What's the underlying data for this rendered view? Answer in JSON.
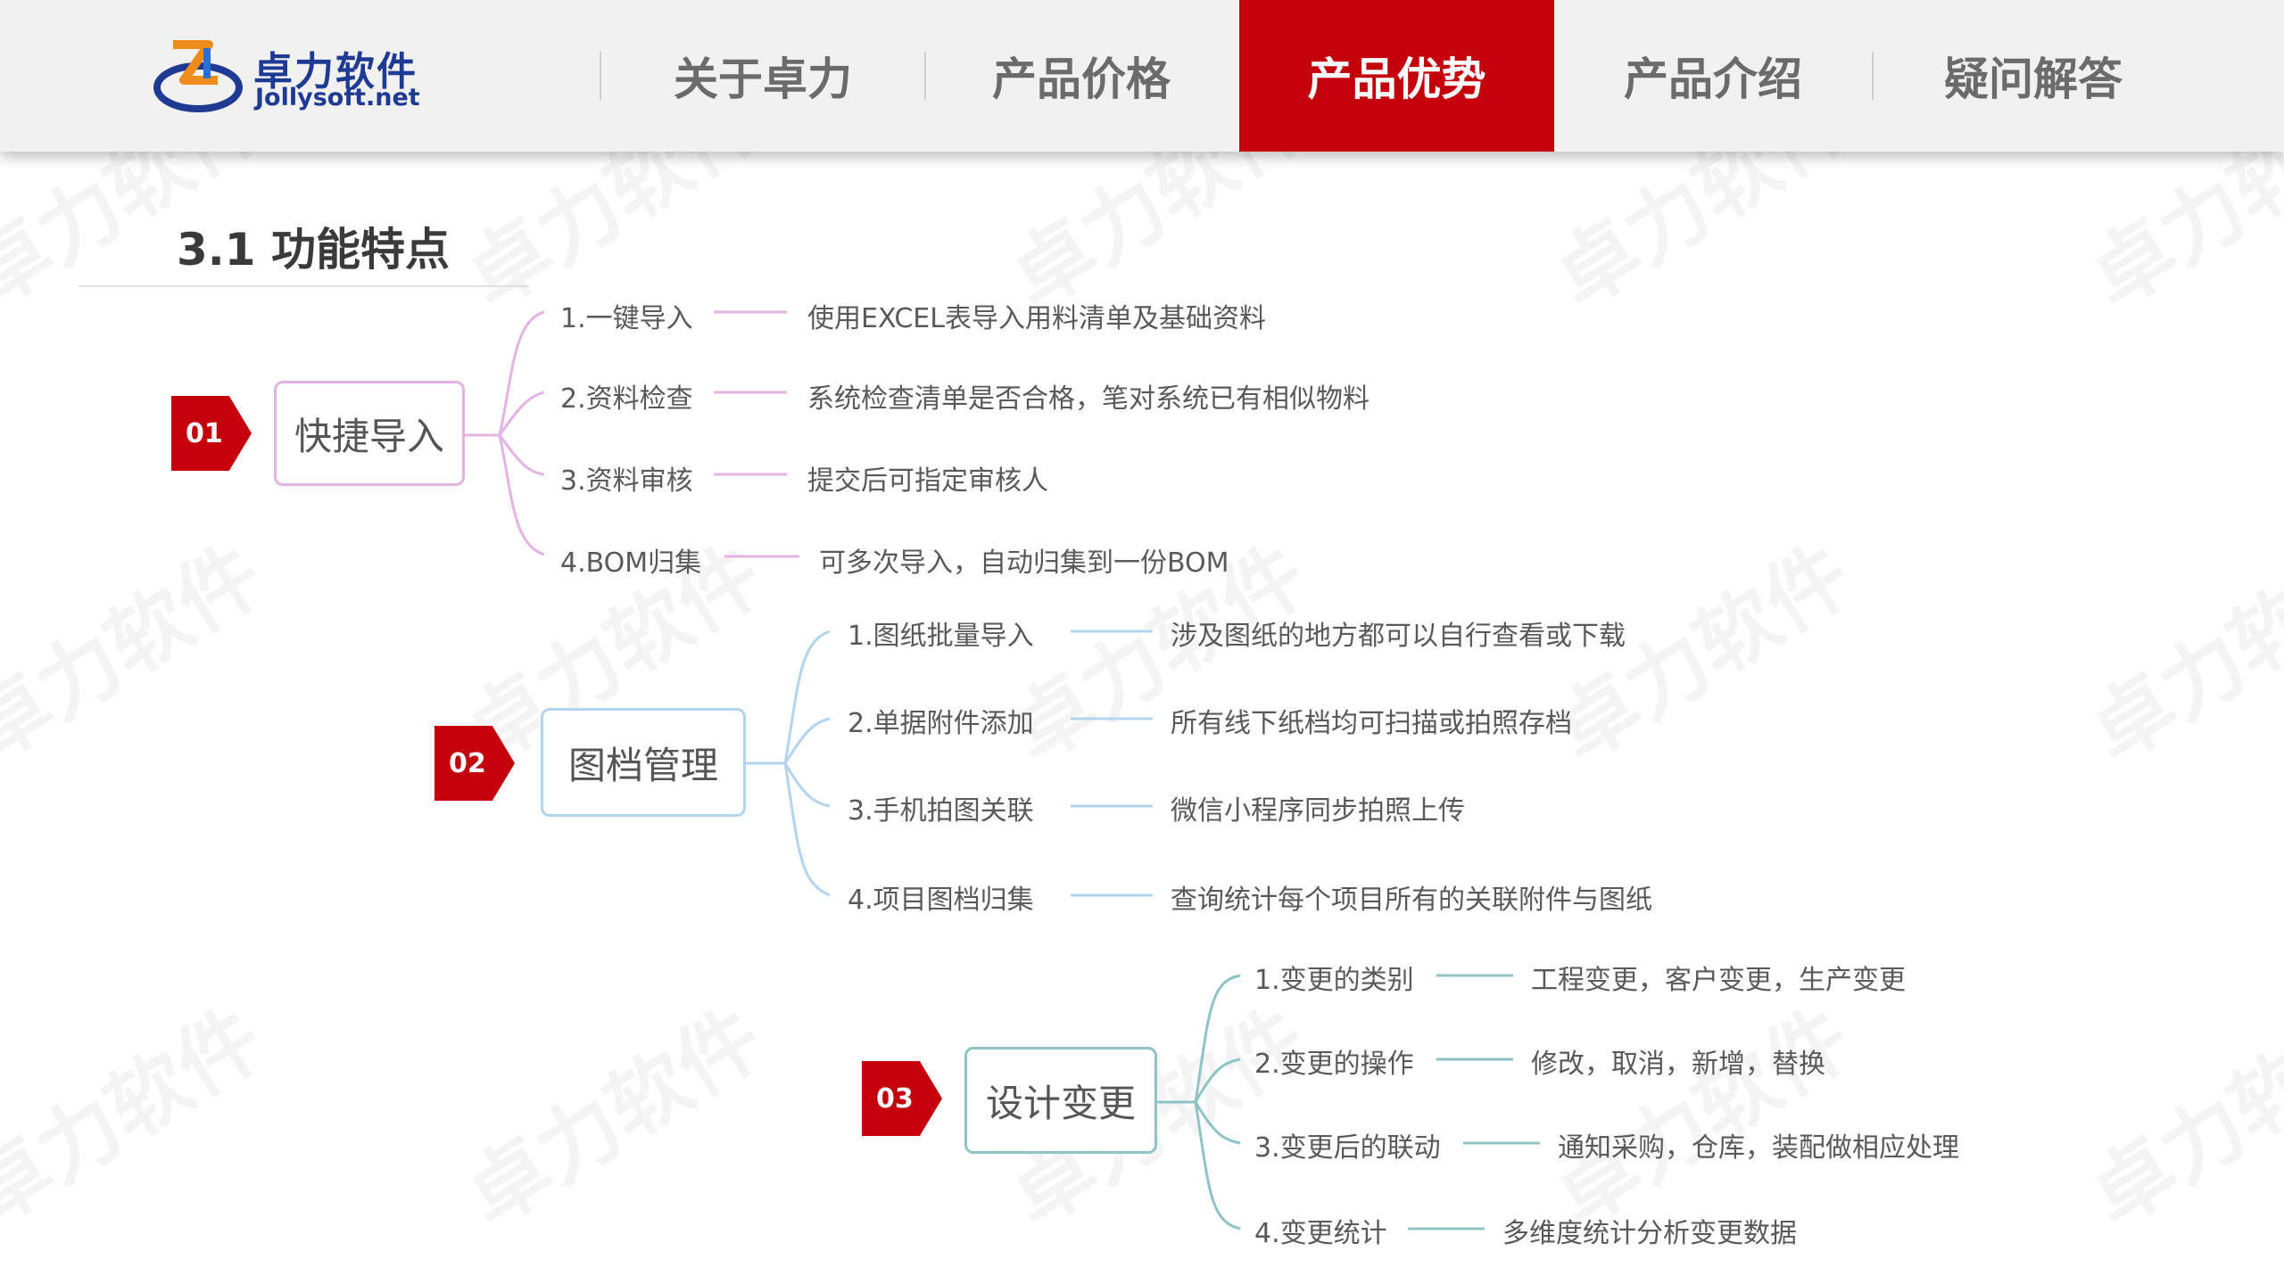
{
  "logo": {
    "name_cn": "卓力软件",
    "name_en": "Jollysoft.net",
    "icon": "jollysoft-logo-icon"
  },
  "nav": [
    {
      "label": "关于卓力",
      "active": false
    },
    {
      "label": "产品价格",
      "active": false
    },
    {
      "label": "产品优势",
      "active": true
    },
    {
      "label": "产品介绍",
      "active": false
    },
    {
      "label": "疑问解答",
      "active": false
    }
  ],
  "section_title": "3.1 功能特点",
  "watermark": "卓力软件",
  "groups": [
    {
      "badge": "01",
      "node": "快捷导入",
      "branch_color": "#e3b4e3",
      "items": [
        {
          "label": "1.一键导入",
          "desc": "使用EXCEL表导入用料清单及基础资料"
        },
        {
          "label": "2.资料检查",
          "desc": "系统检查清单是否合格，笔对系统已有相似物料"
        },
        {
          "label": "3.资料审核",
          "desc": "提交后可指定审核人"
        },
        {
          "label": "4.BOM归集",
          "desc": "可多次导入，自动归集到一份BOM"
        }
      ]
    },
    {
      "badge": "02",
      "node": "图档管理",
      "branch_color": "#b3d4ef",
      "items": [
        {
          "label": "1.图纸批量导入",
          "desc": "涉及图纸的地方都可以自行查看或下载"
        },
        {
          "label": "2.单据附件添加",
          "desc": "所有线下纸档均可扫描或拍照存档"
        },
        {
          "label": "3.手机拍图关联",
          "desc": "微信小程序同步拍照上传"
        },
        {
          "label": "4.项目图档归集",
          "desc": "查询统计每个项目所有的关联附件与图纸"
        }
      ]
    },
    {
      "badge": "03",
      "node": "设计变更",
      "branch_color": "#8fc3c6",
      "items": [
        {
          "label": "1.变更的类别",
          "desc": "工程变更，客户变更，生产变更"
        },
        {
          "label": "2.变更的操作",
          "desc": "修改，取消，新增，替换"
        },
        {
          "label": "3.变更后的联动",
          "desc": "通知采购，仓库，装配做相应处理"
        },
        {
          "label": "4.变更统计",
          "desc": "多维度统计分析变更数据"
        }
      ]
    }
  ]
}
